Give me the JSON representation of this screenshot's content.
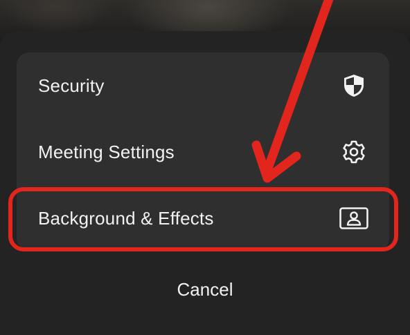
{
  "menu": {
    "items": [
      {
        "label": "Security",
        "icon": "shield-icon"
      },
      {
        "label": "Meeting Settings",
        "icon": "gear-icon"
      },
      {
        "label": "Background & Effects",
        "icon": "person-portrait-icon"
      }
    ],
    "cancel_label": "Cancel"
  },
  "annotation": {
    "highlighted_item": "Background & Effects",
    "color": "#e2261d"
  },
  "colors": {
    "sheet_background": "#232323",
    "card_background": "#2f2f2f",
    "text": "#f2f2f2"
  }
}
